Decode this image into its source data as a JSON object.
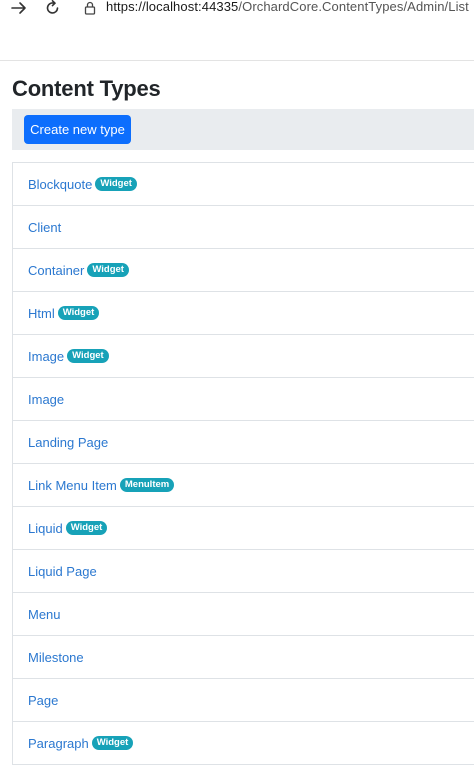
{
  "browser": {
    "url_host": "https://localhost:44335",
    "url_path": "/OrchardCore.ContentTypes/Admin/List",
    "back_icon": "arrow-right-icon",
    "reload_icon": "reload-icon",
    "lock_icon": "lock-icon"
  },
  "page": {
    "title": "Content Types",
    "create_button_label": "Create new type"
  },
  "colors": {
    "primary": "#0d6efd",
    "link": "#2b78d0",
    "badge": "#17a2b8",
    "toolbar_bg": "#e9ecef"
  },
  "content_types": [
    {
      "name": "Blockquote",
      "badge": "Widget"
    },
    {
      "name": "Client",
      "badge": ""
    },
    {
      "name": "Container",
      "badge": "Widget"
    },
    {
      "name": "Html",
      "badge": "Widget"
    },
    {
      "name": "Image",
      "badge": "Widget"
    },
    {
      "name": "Image",
      "badge": ""
    },
    {
      "name": "Landing Page",
      "badge": ""
    },
    {
      "name": "Link Menu Item",
      "badge": "MenuItem"
    },
    {
      "name": "Liquid",
      "badge": "Widget"
    },
    {
      "name": "Liquid Page",
      "badge": ""
    },
    {
      "name": "Menu",
      "badge": ""
    },
    {
      "name": "Milestone",
      "badge": ""
    },
    {
      "name": "Page",
      "badge": ""
    },
    {
      "name": "Paragraph",
      "badge": "Widget"
    }
  ]
}
